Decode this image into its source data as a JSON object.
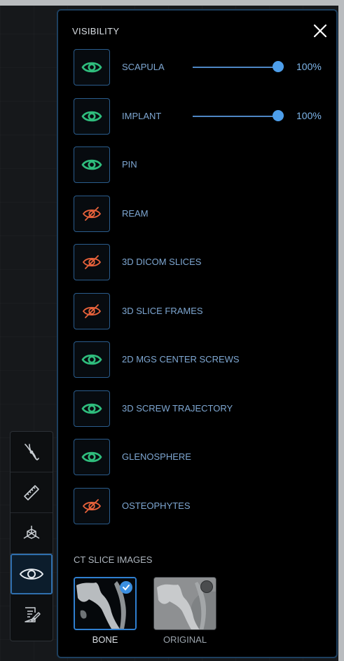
{
  "panel": {
    "title": "VISIBILITY",
    "close_icon": "close-icon"
  },
  "colors": {
    "visible": "#2fbd7d",
    "hidden": "#e8623b",
    "label": "#7ea7d2",
    "accent": "#4d9eea"
  },
  "layers": [
    {
      "label": "SCAPULA",
      "visible": true,
      "icon": "eye-icon",
      "slider": {
        "value": 1.0,
        "text": "100%"
      }
    },
    {
      "label": "IMPLANT",
      "visible": true,
      "icon": "eye-icon",
      "slider": {
        "value": 1.0,
        "text": "100%"
      }
    },
    {
      "label": "PIN",
      "visible": true,
      "icon": "eye-icon"
    },
    {
      "label": "REAM",
      "visible": false,
      "icon": "eye-off-icon"
    },
    {
      "label": "3D DICOM SLICES",
      "visible": false,
      "icon": "eye-off-icon"
    },
    {
      "label": "3D SLICE FRAMES",
      "visible": false,
      "icon": "eye-off-icon"
    },
    {
      "label": "2D MGS CENTER SCREWS",
      "visible": true,
      "icon": "eye-icon"
    },
    {
      "label": "3D SCREW TRAJECTORY",
      "visible": true,
      "icon": "eye-icon"
    },
    {
      "label": "GLENOSPHERE",
      "visible": true,
      "icon": "eye-icon"
    },
    {
      "label": "OSTEOPHYTES",
      "visible": false,
      "icon": "eye-off-icon"
    }
  ],
  "ct_slice": {
    "title": "CT SLICE IMAGES",
    "options": [
      {
        "label": "BONE",
        "selected": true
      },
      {
        "label": "ORIGINAL",
        "selected": false
      }
    ]
  },
  "rail": {
    "tools": [
      {
        "icon": "pliers-icon",
        "active": false
      },
      {
        "icon": "ruler-icon",
        "active": false
      },
      {
        "icon": "axes-cube-icon",
        "active": false
      },
      {
        "icon": "eye-icon",
        "active": true
      },
      {
        "icon": "notes-icon",
        "active": false
      }
    ]
  }
}
